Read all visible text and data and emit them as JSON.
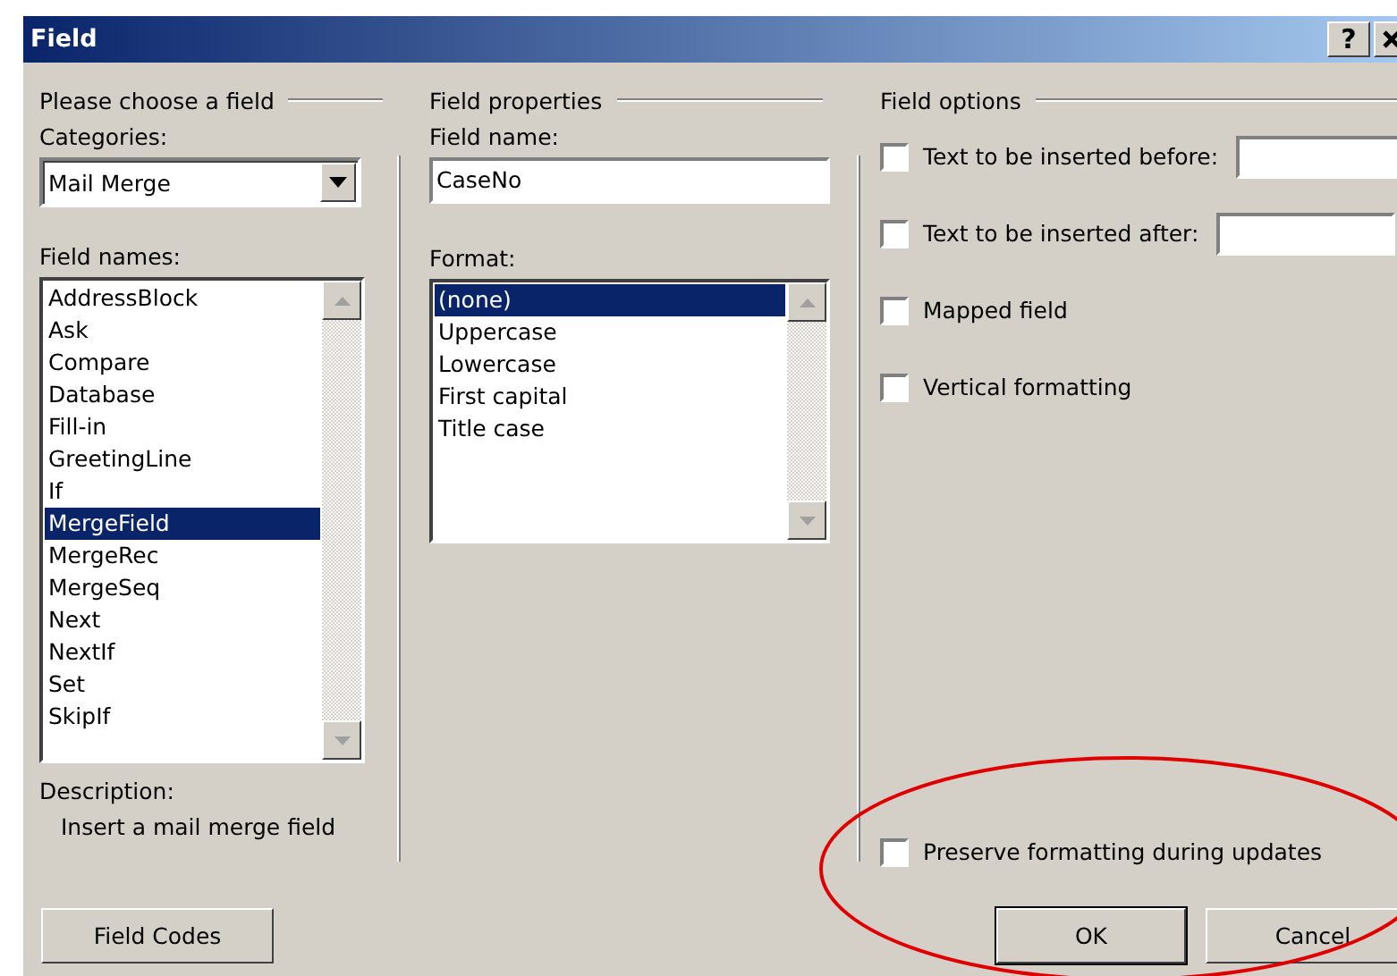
{
  "window": {
    "title": "Field",
    "help_button": "?"
  },
  "choose_group": {
    "heading": "Please choose a field",
    "categories_label": "Categories:",
    "category_value": "Mail Merge",
    "field_names_label": "Field names:",
    "field_names": [
      {
        "label": "AddressBlock",
        "selected": false
      },
      {
        "label": "Ask",
        "selected": false
      },
      {
        "label": "Compare",
        "selected": false
      },
      {
        "label": "Database",
        "selected": false
      },
      {
        "label": "Fill-in",
        "selected": false
      },
      {
        "label": "GreetingLine",
        "selected": false
      },
      {
        "label": "If",
        "selected": false
      },
      {
        "label": "MergeField",
        "selected": true
      },
      {
        "label": "MergeRec",
        "selected": false
      },
      {
        "label": "MergeSeq",
        "selected": false
      },
      {
        "label": "Next",
        "selected": false
      },
      {
        "label": "NextIf",
        "selected": false
      },
      {
        "label": "Set",
        "selected": false
      },
      {
        "label": "SkipIf",
        "selected": false
      }
    ],
    "description_label": "Description:",
    "description": "Insert a mail merge field"
  },
  "properties_group": {
    "heading": "Field properties",
    "field_name_label": "Field name:",
    "field_name_value": "CaseNo",
    "format_label": "Format:",
    "formats": [
      {
        "label": "(none)",
        "selected": true
      },
      {
        "label": "Uppercase",
        "selected": false
      },
      {
        "label": "Lowercase",
        "selected": false
      },
      {
        "label": "First capital",
        "selected": false
      },
      {
        "label": "Title case",
        "selected": false
      }
    ]
  },
  "options_group": {
    "heading": "Field options",
    "options": [
      {
        "kind": "text",
        "label": "Text to be inserted before:",
        "checked": false
      },
      {
        "kind": "text",
        "label": "Text to be inserted after:",
        "checked": false
      },
      {
        "kind": "check",
        "label": "Mapped field",
        "checked": false
      },
      {
        "kind": "check",
        "label": "Vertical formatting",
        "checked": false
      }
    ],
    "preserve": {
      "label": "Preserve formatting during updates",
      "checked": false
    }
  },
  "buttons": {
    "field_codes": "Field Codes",
    "ok": "OK",
    "cancel": "Cancel"
  },
  "annotation": {
    "kind": "ellipse"
  }
}
